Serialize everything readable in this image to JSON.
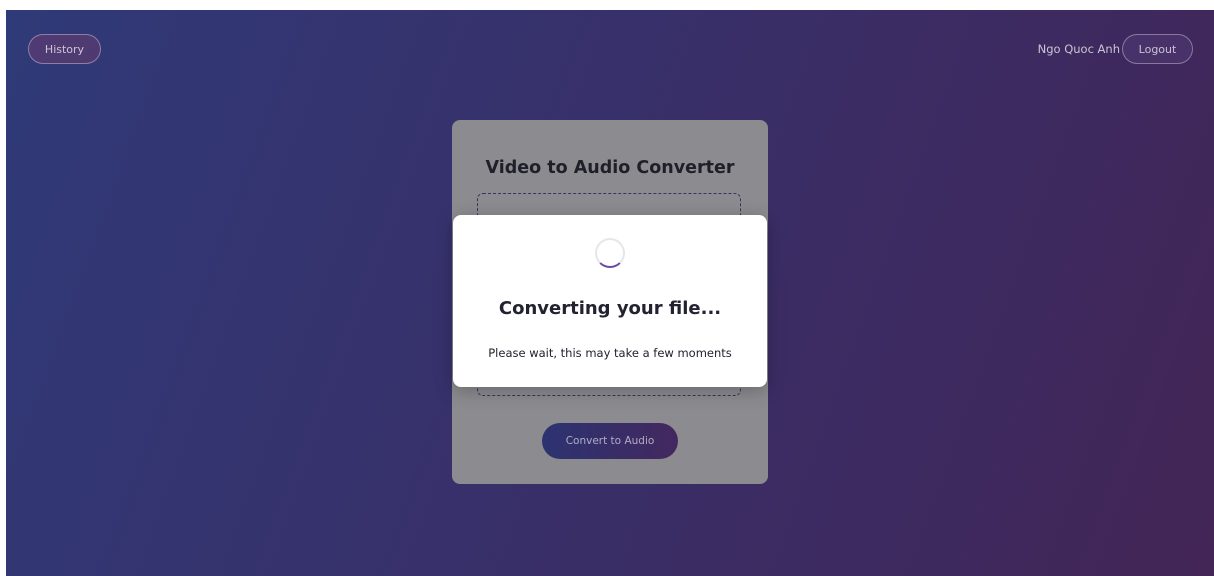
{
  "header": {
    "history_label": "History",
    "username": "Ngo Quoc Anh",
    "logout_label": "Logout"
  },
  "converter": {
    "title": "Video to Audio Converter",
    "convert_label": "Convert to Audio"
  },
  "modal": {
    "title": "Converting your file...",
    "subtitle": "Please wait, this may take a few moments"
  },
  "icons": {
    "spinner": "loading-spinner-icon"
  },
  "colors": {
    "background_start": "#2f3a78",
    "background_end": "#432556",
    "accent": "#6c4aa8",
    "modal_bg": "#ffffff"
  }
}
